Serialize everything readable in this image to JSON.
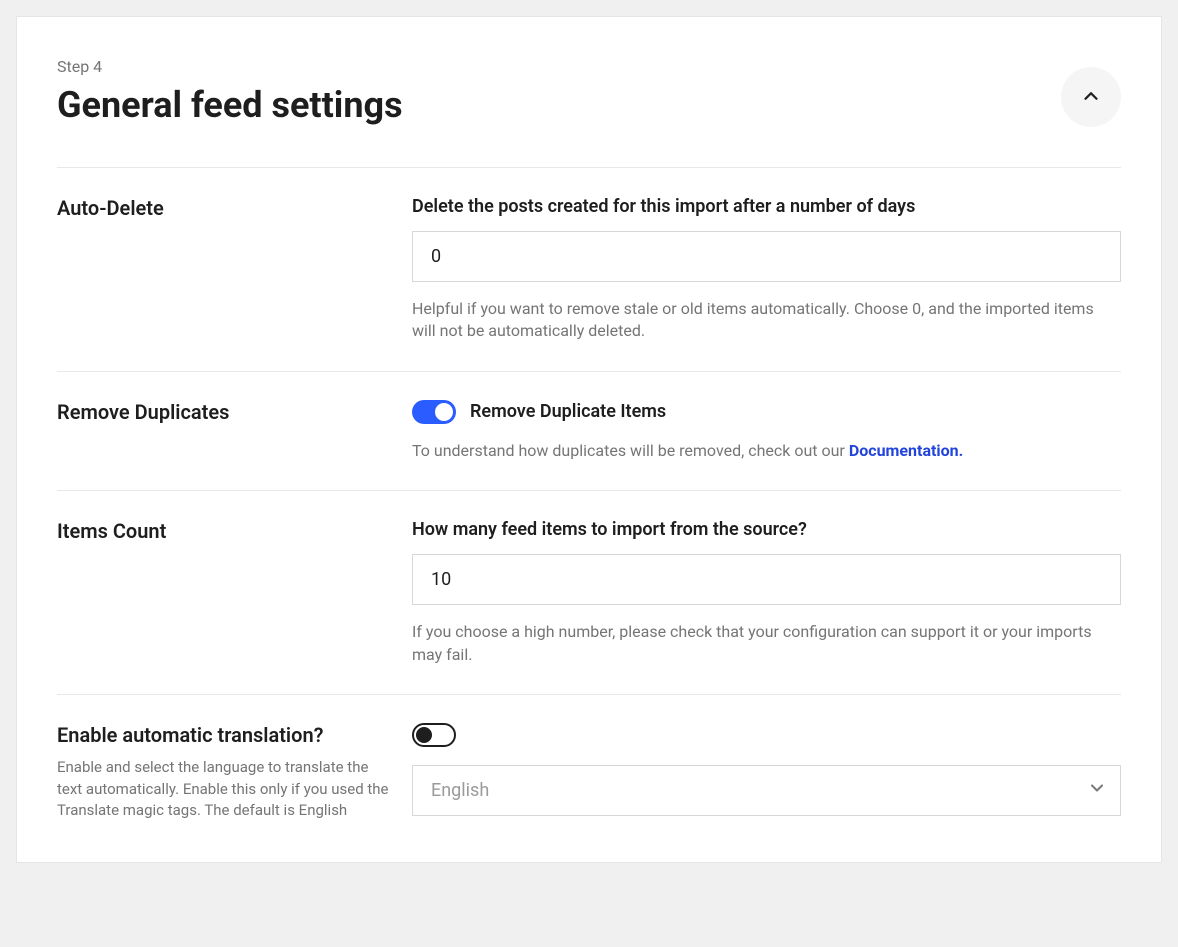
{
  "header": {
    "step": "Step 4",
    "title": "General feed settings"
  },
  "autoDelete": {
    "label": "Auto-Delete",
    "fieldLabel": "Delete the posts created for this import after a number of days",
    "value": "0",
    "help": "Helpful if you want to remove stale or old items automatically. Choose 0, and the imported items will not be automatically deleted."
  },
  "removeDuplicates": {
    "label": "Remove Duplicates",
    "toggleLabel": "Remove Duplicate Items",
    "helpPrefix": "To understand how duplicates will be removed, check out our ",
    "helpLink": "Documentation."
  },
  "itemsCount": {
    "label": "Items Count",
    "fieldLabel": "How many feed items to import from the source?",
    "value": "10",
    "help": "If you choose a high number, please check that your configuration can support it or your imports may fail."
  },
  "translation": {
    "label": "Enable automatic translation?",
    "sub": "Enable and select the language to translate the text automatically. Enable this only if you used the Translate magic tags. The default is English",
    "selectValue": "English"
  }
}
